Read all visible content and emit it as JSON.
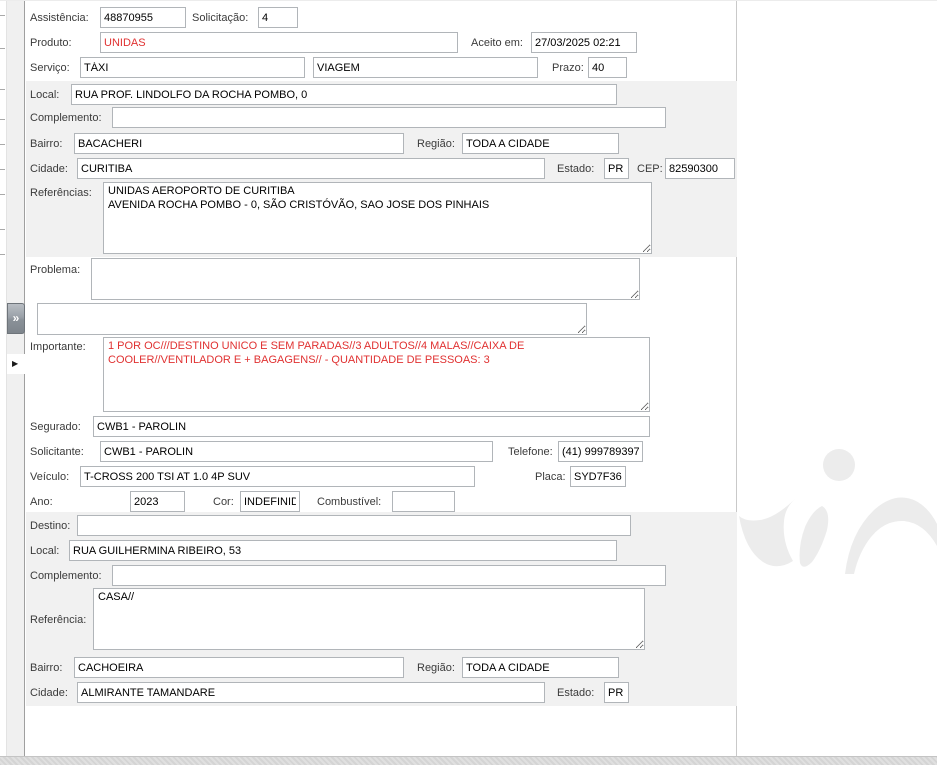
{
  "icons": {
    "expander": "»",
    "mini_arrow": "▶"
  },
  "colors": {
    "alert_text": "#e03131",
    "section_bg": "#f1f1f1"
  },
  "form": {
    "assistencia": {
      "label": "Assistência:",
      "value": "48870955"
    },
    "solicitacao": {
      "label": "Solicitação:",
      "value": "4"
    },
    "produto": {
      "label": "Produto:",
      "value": "UNIDAS"
    },
    "aceito_em": {
      "label": "Aceito em:",
      "value": "27/03/2025 02:21"
    },
    "servico": {
      "label": "Serviço:",
      "value": "TÁXI",
      "value2": "VIAGEM"
    },
    "prazo": {
      "label": "Prazo:",
      "value": "40"
    },
    "origem": {
      "local": {
        "label": "Local:",
        "value": "RUA PROF. LINDOLFO DA ROCHA POMBO, 0"
      },
      "complemento": {
        "label": "Complemento:",
        "value": ""
      },
      "bairro": {
        "label": "Bairro:",
        "value": "BACACHERI"
      },
      "regiao": {
        "label": "Região:",
        "value": "TODA A CIDADE"
      },
      "cidade": {
        "label": "Cidade:",
        "value": "CURITIBA"
      },
      "estado": {
        "label": "Estado:",
        "value": "PR"
      },
      "cep": {
        "label": "CEP:",
        "value": "82590300"
      },
      "referencias": {
        "label": "Referências:",
        "value": "UNIDAS AEROPORTO DE CURITIBA\nAVENIDA ROCHA POMBO - 0, SÃO CRISTÓVÃO, SAO JOSE DOS PINHAIS"
      }
    },
    "problema": {
      "label": "Problema:",
      "value": ""
    },
    "observacao": {
      "value": ""
    },
    "importante": {
      "label": "Importante:",
      "value": "1 POR OC///DESTINO UNICO E SEM PARADAS//3 ADULTOS//4 MALAS//CAIXA DE COOLER//VENTILADOR E + BAGAGENS// - QUANTIDADE DE PESSOAS: 3"
    },
    "segurado": {
      "label": "Segurado:",
      "value": "CWB1 - PAROLIN"
    },
    "solicitante": {
      "label": "Solicitante:",
      "value": "CWB1 - PAROLIN"
    },
    "telefone": {
      "label": "Telefone:",
      "value": "(41) 999789397"
    },
    "veiculo": {
      "label": "Veículo:",
      "value": "T-CROSS 200 TSI AT 1.0 4P SUV"
    },
    "placa": {
      "label": "Placa:",
      "value": "SYD7F36"
    },
    "ano": {
      "label": "Ano:",
      "value": "2023"
    },
    "cor": {
      "label": "Cor:",
      "value": "INDEFINIDA"
    },
    "combustivel": {
      "label": "Combustível:",
      "value": ""
    },
    "destino": {
      "destino": {
        "label": "Destino:",
        "value": ""
      },
      "local": {
        "label": "Local:",
        "value": "RUA GUILHERMINA RIBEIRO, 53"
      },
      "complemento": {
        "label": "Complemento:",
        "value": ""
      },
      "referencia": {
        "label": "Referência:",
        "value": "CASA//"
      },
      "bairro": {
        "label": "Bairro:",
        "value": "CACHOEIRA"
      },
      "regiao": {
        "label": "Região:",
        "value": "TODA A CIDADE"
      },
      "cidade": {
        "label": "Cidade:",
        "value": "ALMIRANTE TAMANDARE"
      },
      "estado": {
        "label": "Estado:",
        "value": "PR"
      }
    }
  }
}
